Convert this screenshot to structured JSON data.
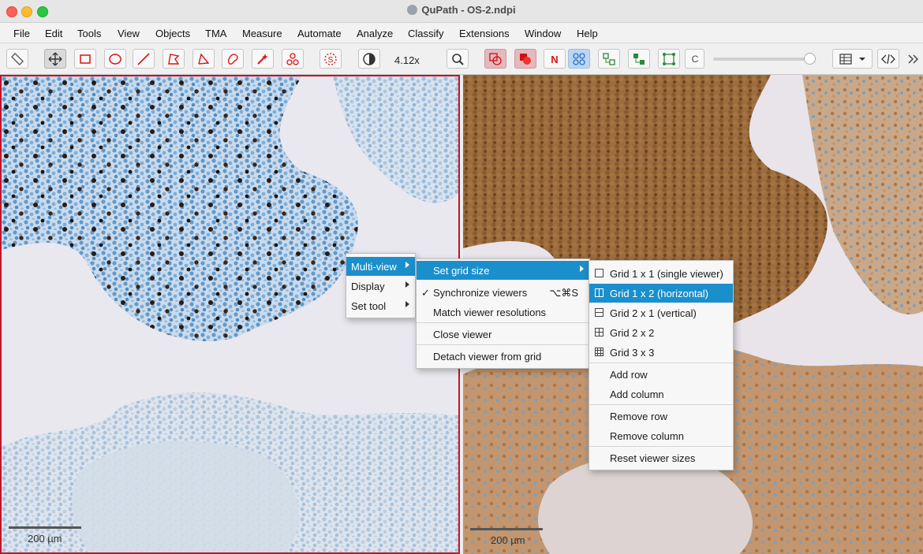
{
  "window": {
    "title": "QuPath - OS-2.ndpi"
  },
  "menubar": [
    "File",
    "Edit",
    "Tools",
    "View",
    "Objects",
    "TMA",
    "Measure",
    "Automate",
    "Analyze",
    "Classify",
    "Extensions",
    "Window",
    "Help"
  ],
  "toolbar": {
    "zoom": "4.12x",
    "n_label": "N",
    "c_label": "C",
    "slider_value": 0.95
  },
  "viewers": {
    "left_scale": "200 µm",
    "right_scale": "200 µm"
  },
  "context_menu": {
    "items": [
      {
        "label": "Multi-view"
      },
      {
        "label": "Display"
      },
      {
        "label": "Set tool"
      }
    ]
  },
  "multiview_menu": {
    "items": [
      {
        "label": "Set grid size"
      },
      {
        "label": "Synchronize viewers",
        "shortcut": "⌥⌘S",
        "check": "✓"
      },
      {
        "label": "Match viewer resolutions"
      },
      {
        "label": "Close viewer"
      },
      {
        "label": "Detach viewer from grid"
      }
    ]
  },
  "grid_menu": {
    "items": [
      {
        "label": "Grid 1 x 1 (single viewer)"
      },
      {
        "label": "Grid 1 x 2 (horizontal)"
      },
      {
        "label": "Grid 2 x 1 (vertical)"
      },
      {
        "label": "Grid 2 x 2"
      },
      {
        "label": "Grid 3 x 3"
      },
      {
        "label": "Add row"
      },
      {
        "label": "Add column"
      },
      {
        "label": "Remove row"
      },
      {
        "label": "Remove column"
      },
      {
        "label": "Reset viewer sizes"
      }
    ]
  }
}
